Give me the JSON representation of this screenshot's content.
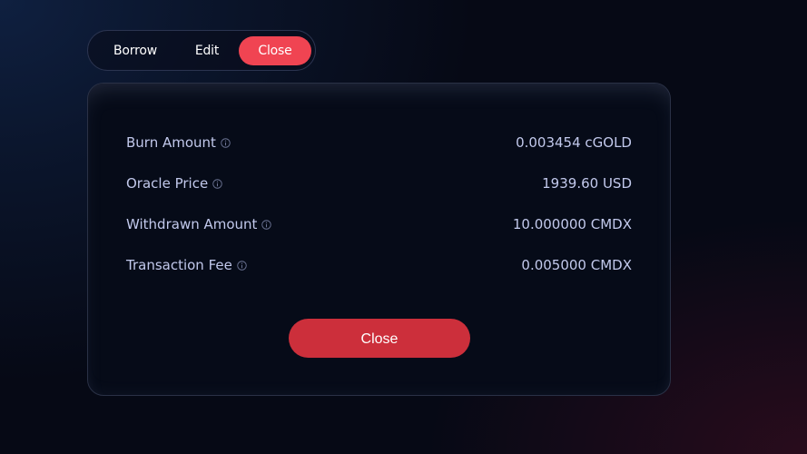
{
  "tabs": {
    "items": [
      {
        "label": "Borrow",
        "active": false
      },
      {
        "label": "Edit",
        "active": false
      },
      {
        "label": "Close",
        "active": true
      }
    ],
    "active_color": "#f04452"
  },
  "card": {
    "rows": [
      {
        "label": "Burn Amount",
        "value": "0.003454 cGOLD",
        "icon": "info-icon"
      },
      {
        "label": "Oracle Price",
        "value": "1939.60 USD",
        "icon": "info-icon"
      },
      {
        "label": "Withdrawn Amount",
        "value": "10.000000 CMDX",
        "icon": "info-icon"
      },
      {
        "label": "Transaction Fee",
        "value": "0.005000 CMDX",
        "icon": "info-icon"
      }
    ],
    "submit_label": "Close",
    "submit_color": "#cc2f3b"
  }
}
